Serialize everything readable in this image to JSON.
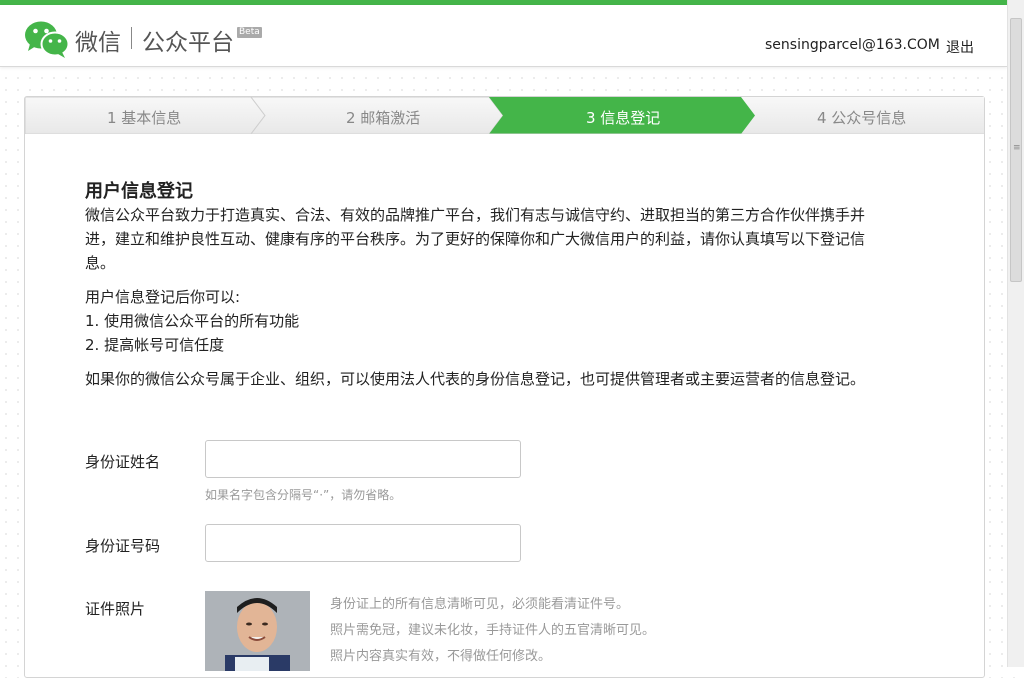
{
  "header": {
    "brand_name": "微信",
    "brand_platform": "公众平台",
    "beta_badge": "Beta",
    "user_email": "sensingparcel@163.COM",
    "logout_label": "退出",
    "accent_color": "#44b549"
  },
  "steps": [
    {
      "label": "1 基本信息",
      "state": "done"
    },
    {
      "label": "2 邮箱激活",
      "state": "done"
    },
    {
      "label": "3 信息登记",
      "state": "active"
    },
    {
      "label": "4 公众号信息",
      "state": "todo"
    }
  ],
  "intro": {
    "title": "用户信息登记",
    "line1": "微信公众平台致力于打造真实、合法、有效的品牌推广平台，我们有志与诚信守约、进取担当的第三方合作伙伴携手并",
    "line2": "进，建立和维护良性互动、健康有序的平台秩序。为了更好的保障你和广大微信用户的利益，请你认真填写以下登记信",
    "line3": "息。",
    "benefits_heading": "用户信息登记后你可以:",
    "benefit1": "1. 使用微信公众平台的所有功能",
    "benefit2": "2. 提高帐号可信任度",
    "note": "如果你的微信公众号属于企业、组织，可以使用法人代表的身份信息登记，也可提供管理者或主要运营者的信息登记。"
  },
  "form": {
    "name_label": "身份证姓名",
    "name_value": "",
    "name_hint": "如果名字包含分隔号“·”，请勿省略。",
    "id_label": "身份证号码",
    "id_value": "",
    "photo_label": "证件照片",
    "photo_note1": "身份证上的所有信息清晰可见，必须能看清证件号。",
    "photo_note2": "照片需免冠，建议未化妆，手持证件人的五官清晰可见。",
    "photo_note3": "照片内容真实有效，不得做任何修改。"
  }
}
